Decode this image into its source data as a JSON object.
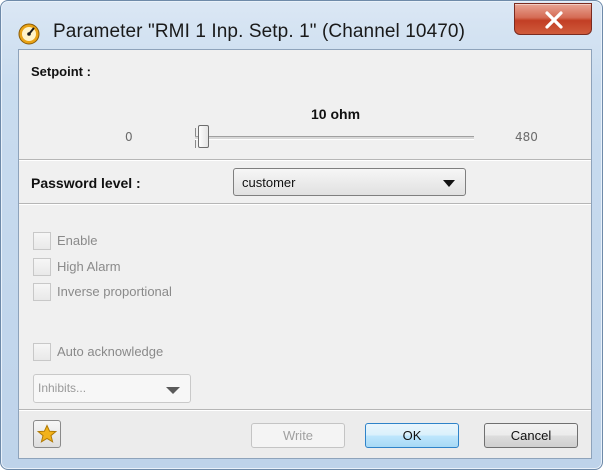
{
  "window": {
    "title": "Parameter \"RMI 1 Inp. Setp. 1\" (Channel 10470)",
    "icon": "gauge-icon",
    "close_icon": "close-icon"
  },
  "setpoint": {
    "label": "Setpoint :",
    "value_text": "10 ohm",
    "min": "0",
    "max": "480",
    "value": 10
  },
  "password": {
    "label": "Password level :",
    "selected": "customer"
  },
  "options": [
    {
      "label": "Enable",
      "checked": false,
      "enabled": false
    },
    {
      "label": "High Alarm",
      "checked": false,
      "enabled": false
    },
    {
      "label": "Inverse proportional",
      "checked": false,
      "enabled": false
    }
  ],
  "auto_ack": {
    "label": "Auto acknowledge",
    "checked": false,
    "enabled": false
  },
  "inhibits": {
    "placeholder": "Inhibits..."
  },
  "footer": {
    "favorite_icon": "star-icon",
    "write_label": "Write",
    "ok_label": "OK",
    "cancel_label": "Cancel"
  },
  "colors": {
    "accent": "#2f83c9",
    "close": "#c23e24",
    "star": "#f2b21a"
  }
}
